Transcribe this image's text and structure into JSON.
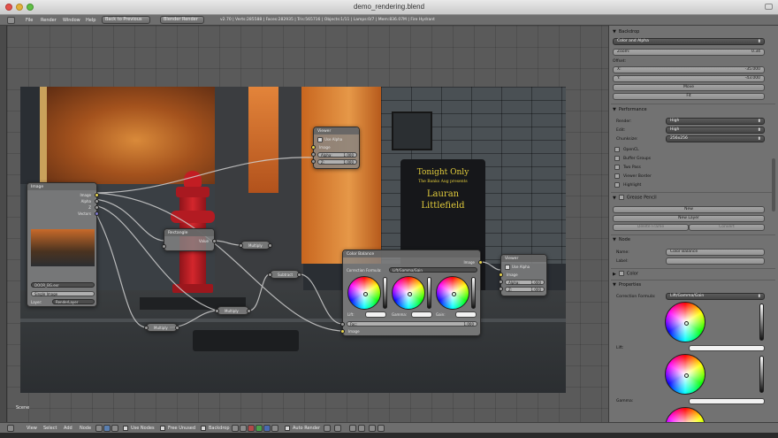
{
  "window": {
    "title": "demo_rendering.blend"
  },
  "header": {
    "menus": [
      "File",
      "Render",
      "Window",
      "Help"
    ],
    "back_button": "Back to Previous",
    "engine": "Blender Render",
    "stats": "v2.70 | Verts:285588 | Faces:282935 | Tris:565716 | Objects:1/11 | Lamps:0/7 | Mem:836.07M | Fire Hydrant"
  },
  "nodes": {
    "image": {
      "title": "Image",
      "out_image": "Image",
      "out_alpha": "Alpha",
      "out_z": "Z",
      "out_vectors": "Vectors",
      "source": "Single Image",
      "layer_label": "Layer:",
      "layer_value": "RenderLayer",
      "file": "DOOR_BG.exr"
    },
    "viewer_top": {
      "title": "Viewer",
      "use_alpha": "Use Alpha",
      "in_image": "Image",
      "alpha": "Alpha:",
      "alpha_val": "1.000",
      "z": "Z:",
      "z_val": "1.000"
    },
    "viewer_right": {
      "title": "Viewer",
      "use_alpha": "Use Alpha",
      "in_image": "Image",
      "alpha": "Alpha:",
      "alpha_val": "1.000",
      "z": "Z:",
      "z_val": "1.000"
    },
    "rectangle": {
      "title": "Rectangle",
      "out": "Value"
    },
    "color_balance": {
      "title": "Color Balance",
      "out": "Image",
      "formula_label": "Correction Formula:",
      "formula": "Lift/Gamma/Gain",
      "lift": "Lift:",
      "gamma": "Gamma:",
      "gain": "Gain:",
      "fac": "Fac:",
      "fac_val": "1.000",
      "image": "Image"
    },
    "reroutes": [
      "Multiply",
      "Subtract",
      "Multiply",
      "Multiply"
    ]
  },
  "props": {
    "backdrop": {
      "title": "Backdrop",
      "channels": "Color and Alpha",
      "zoom_label": "Zoom:",
      "zoom_value": "0.34",
      "offset_label": "Offset:",
      "x_label": "X:",
      "x_value": "-35.000",
      "y_label": "Y:",
      "y_value": "-43.000",
      "move": "Move",
      "fit": "Fit"
    },
    "performance": {
      "title": "Performance",
      "render_label": "Render:",
      "render_value": "High",
      "edit_label": "Edit:",
      "edit_value": "High",
      "chunk_label": "Chunksize:",
      "chunk_value": "256x256",
      "checks": [
        "OpenCL",
        "Buffer Groups",
        "Two Pass",
        "Viewer Border",
        "Highlight"
      ]
    },
    "grease_pencil": {
      "title": "Grease Pencil",
      "new": "New",
      "new_layer": "New Layer",
      "delete_frame": "Delete Frame",
      "convert": "Convert"
    },
    "node": {
      "title": "Node",
      "name_label": "Name:",
      "name_value": "Color Balance",
      "label_label": "Label:"
    },
    "color": {
      "title": "Color"
    },
    "properties": {
      "title": "Properties",
      "formula_label": "Correction Formula:",
      "formula_value": "Lift/Gamma/Gain",
      "lift": "Lift:",
      "gamma": "Gamma:"
    }
  },
  "scene_label": "Scene",
  "footer": {
    "menus": [
      "View",
      "Select",
      "Add",
      "Node"
    ],
    "use_nodes": "Use Nodes",
    "free_unused": "Free Unused",
    "backdrop": "Backdrop",
    "auto_render": "Auto Render"
  },
  "backdrop_image": {
    "sign_line1": "Tonight Only",
    "sign_line2": "The Banks Aug presents",
    "sign_line3": "Lauran",
    "sign_line4": "Littlefield"
  },
  "colors": {
    "node_socket": "#e8d44d",
    "panel_bg": "#727272",
    "editor_bg": "#5a5a5a"
  }
}
